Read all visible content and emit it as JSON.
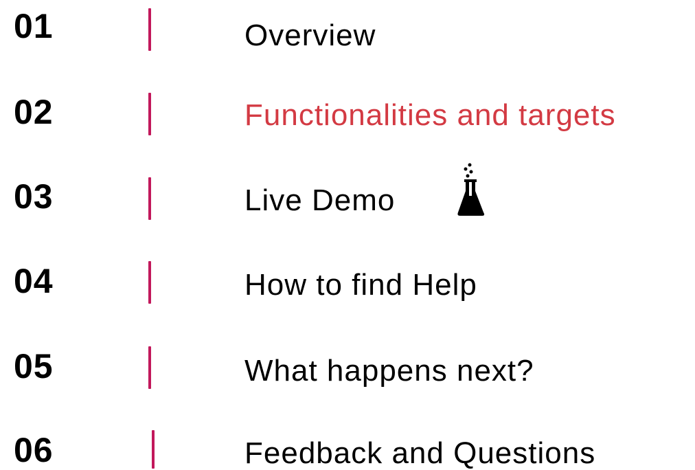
{
  "colors": {
    "accent_bar": "#C2185B",
    "highlight_text": "#D33A43",
    "default_text": "#000000"
  },
  "agenda": {
    "items": [
      {
        "number": "01",
        "label": "Overview",
        "highlighted": false
      },
      {
        "number": "02",
        "label": "Functionalities and targets",
        "highlighted": true
      },
      {
        "number": "03",
        "label": "Live Demo",
        "highlighted": false,
        "icon": "flask-icon"
      },
      {
        "number": "04",
        "label": "How to find Help",
        "highlighted": false
      },
      {
        "number": "05",
        "label": "What happens next?",
        "highlighted": false
      },
      {
        "number": "06",
        "label": "Feedback and Questions",
        "highlighted": false
      }
    ]
  }
}
